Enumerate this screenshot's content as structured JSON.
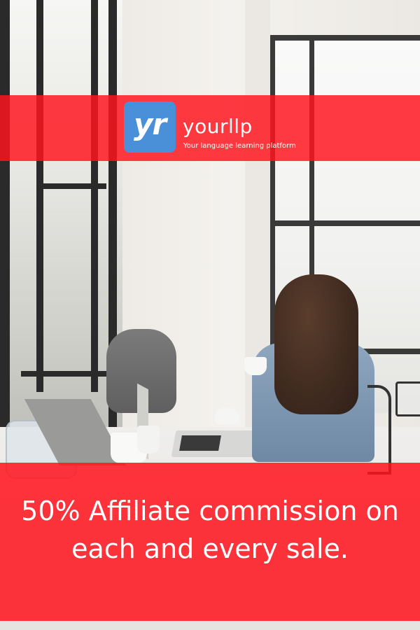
{
  "brand": {
    "logo_mark": "yr",
    "name": "yourllp",
    "tagline": "Your language learning platform",
    "logo_color": "#4a90d9"
  },
  "banner": {
    "headline": "50% Affiliate commission on each and every sale.",
    "band_color": "#ff141e"
  },
  "background": {
    "description": ""
  }
}
